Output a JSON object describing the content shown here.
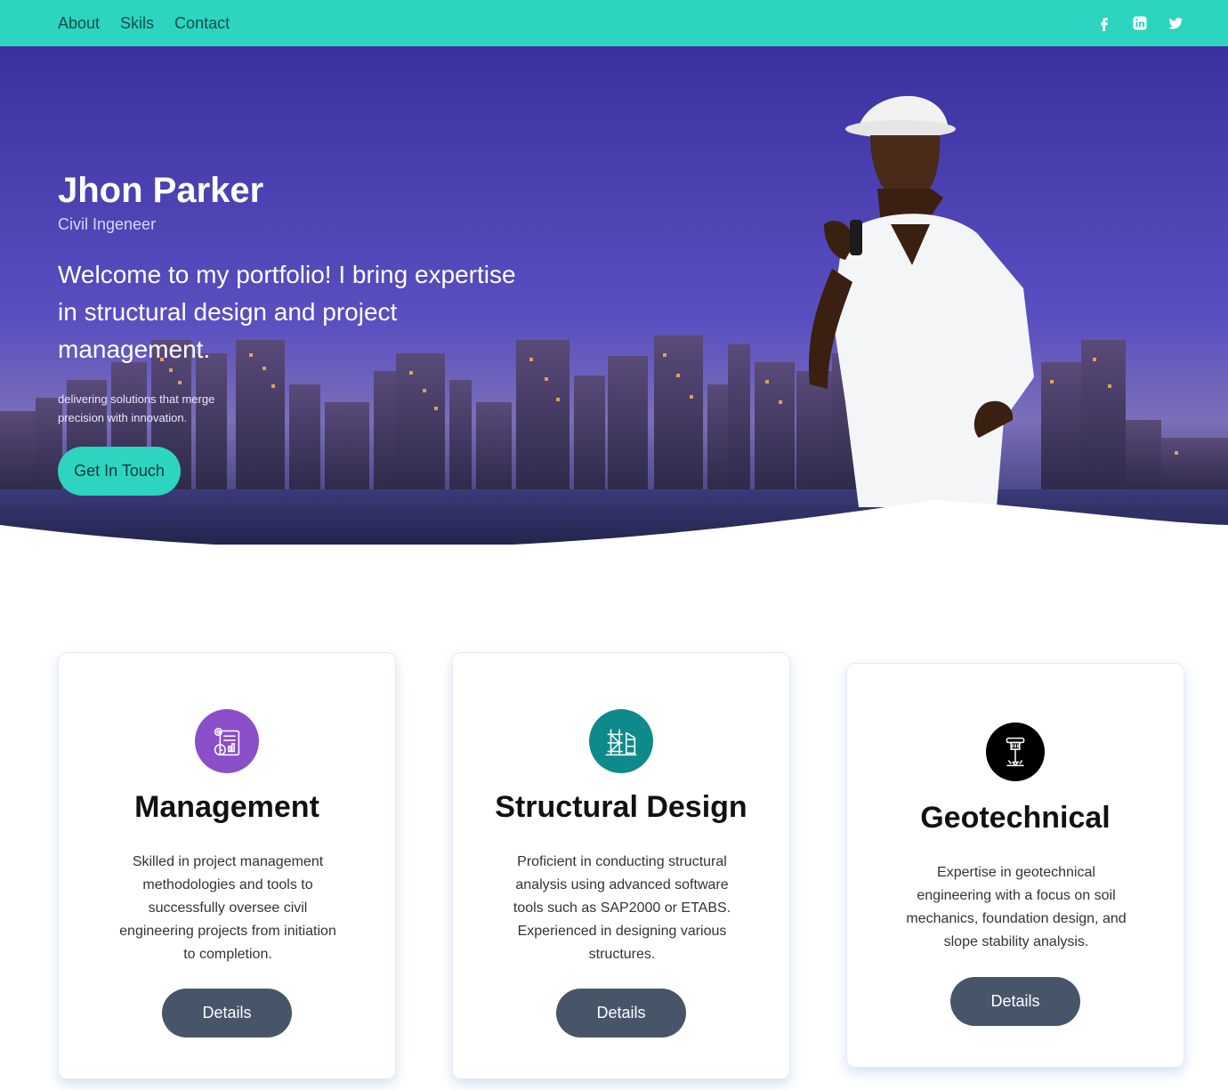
{
  "nav": {
    "links": [
      "About",
      "Skils",
      "Contact"
    ],
    "social": [
      "facebook-icon",
      "linkedin-icon",
      "twitter-icon"
    ]
  },
  "hero": {
    "name": "Jhon Parker",
    "role": "Civil Ingeneer",
    "welcome": "Welcome to my portfolio! I bring expertise in structural design and project management.",
    "tagline": "delivering solutions that merge precision with innovation.",
    "cta": "Get In Touch"
  },
  "cards": [
    {
      "title": "Management",
      "icon": "management-icon",
      "description": "Skilled in project management methodologies and tools to successfully oversee civil engineering projects from initiation to completion.",
      "button": "Details"
    },
    {
      "title": "Structural Design",
      "icon": "structure-icon",
      "description": "Proficient in conducting structural analysis using advanced software tools such as SAP2000 or ETABS. Experienced in designing various structures.",
      "button": "Details"
    },
    {
      "title": "Geotechnical",
      "icon": "drill-icon",
      "description": "Expertise in geotechnical engineering with a focus on soil mechanics, foundation design, and slope stability analysis.",
      "button": "Details"
    }
  ],
  "colors": {
    "accent": "#2dd4bf",
    "button": "#475569",
    "hero_sky": "#3f35a6",
    "management_icon": "#8b4fc9",
    "structure_icon": "#0f8a8c",
    "drill_icon": "#000000"
  }
}
